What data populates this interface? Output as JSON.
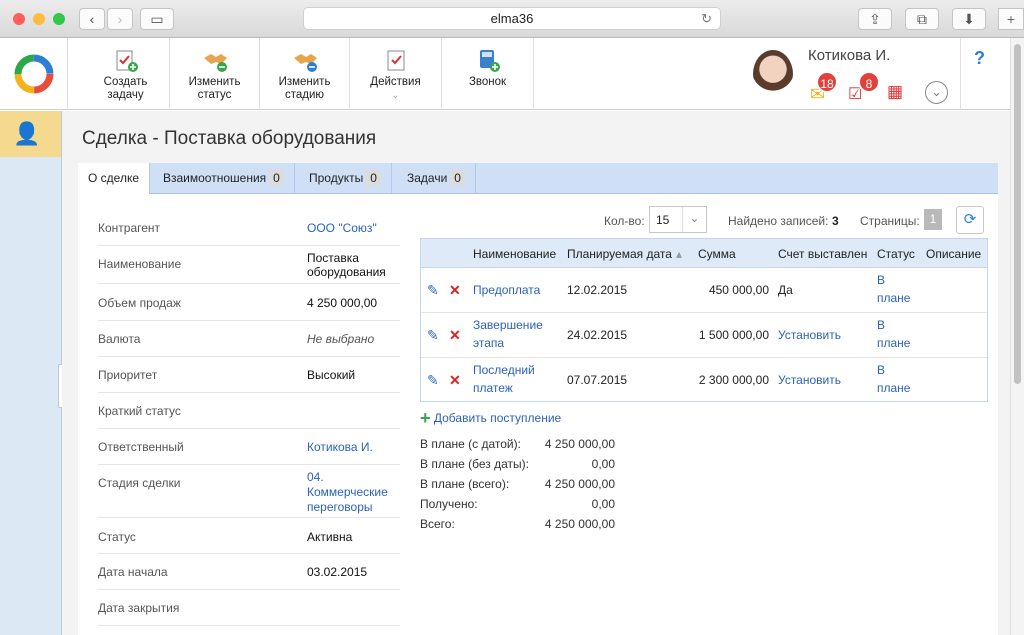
{
  "browser": {
    "url": "elma36"
  },
  "toolbar": {
    "create_task": "Создать задачу",
    "change_status": "Изменить статус",
    "change_stage": "Изменить стадию",
    "actions": "Действия",
    "call": "Звонок"
  },
  "user": {
    "name": "Котикова И.",
    "messages_count": "18",
    "tasks_count": "8"
  },
  "page": {
    "title": "Сделка - Поставка оборудования"
  },
  "tabs": [
    {
      "label": "О сделке"
    },
    {
      "label": "Взаимоотношения",
      "count": "0"
    },
    {
      "label": "Продукты",
      "count": "0"
    },
    {
      "label": "Задачи",
      "count": "0"
    }
  ],
  "fields": [
    {
      "label": "Контрагент",
      "value": "ООО \"Союз\""
    },
    {
      "label": "Наименование",
      "value": "Поставка оборудования"
    },
    {
      "label": "Объем продаж",
      "value": "4 250 000,00"
    },
    {
      "label": "Валюта",
      "value": "Не выбрано"
    },
    {
      "label": "Приоритет",
      "value": "Высокий"
    },
    {
      "label": "Краткий статус",
      "value": ""
    },
    {
      "label": "Ответственный",
      "value": "Котикова И."
    },
    {
      "label": "Стадия сделки",
      "value": "04. Коммерческие переговоры"
    },
    {
      "label": "Статус",
      "value": "Активна"
    },
    {
      "label": "Дата начала",
      "value": "03.02.2015"
    },
    {
      "label": "Дата закрытия",
      "value": ""
    }
  ],
  "grid_controls": {
    "count_label": "Кол-во:",
    "count_value": "15",
    "found_label": "Найдено записей:",
    "found_value": "3",
    "pages_label": "Страницы:",
    "page_value": "1"
  },
  "grid": {
    "columns": [
      "Наименование",
      "Планируемая дата",
      "Сумма",
      "Счет выставлен",
      "Статус",
      "Описание"
    ],
    "rows": [
      {
        "name": "Предоплата",
        "date": "12.02.2015",
        "sum": "450 000,00",
        "invoice": "Да",
        "status": "В плане"
      },
      {
        "name": "Завершение этапа",
        "date": "24.02.2015",
        "sum": "1 500 000,00",
        "invoice": "Установить",
        "status": "В плане"
      },
      {
        "name": "Последний платеж",
        "date": "07.07.2015",
        "sum": "2 300 000,00",
        "invoice": "Установить",
        "status": "В плане"
      }
    ],
    "add_label": "Добавить поступление"
  },
  "totals": [
    {
      "label": "В плане (с датой):",
      "value": "4 250 000,00"
    },
    {
      "label": "В плане (без даты):",
      "value": "0,00"
    },
    {
      "label": "В плане (всего):",
      "value": "4 250 000,00"
    },
    {
      "label": "Получено:",
      "value": "0,00"
    },
    {
      "label": "Всего:",
      "value": "4 250 000,00"
    }
  ]
}
